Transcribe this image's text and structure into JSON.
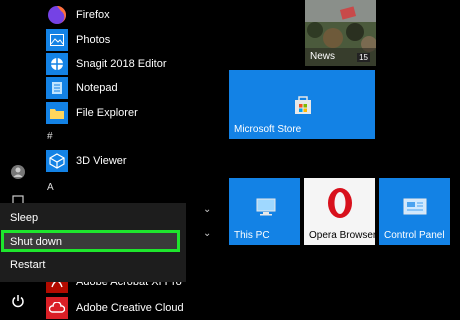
{
  "apps": [
    {
      "label": "Firefox",
      "icon": "firefox-icon"
    },
    {
      "label": "Photos",
      "icon": "photos-icon"
    },
    {
      "label": "Snagit 2018 Editor",
      "icon": "snagit-icon"
    },
    {
      "label": "Notepad",
      "icon": "notepad-icon"
    },
    {
      "label": "File Explorer",
      "icon": "file-explorer-icon"
    },
    {
      "label": "3D Viewer",
      "icon": "3d-viewer-icon"
    },
    {
      "label": "Adobe Acrobat XI Pro",
      "icon": "acrobat-icon"
    },
    {
      "label": "Adobe Creative Cloud",
      "icon": "creative-cloud-icon"
    }
  ],
  "section_headers": {
    "hash": "#",
    "a": "A"
  },
  "power_menu": {
    "sleep": "Sleep",
    "shut_down": "Shut down",
    "restart": "Restart"
  },
  "tiles": {
    "news": "News",
    "news_badge": "15",
    "store": "Microsoft Store",
    "this_pc": "This PC",
    "opera": "Opera Browser",
    "control_panel": "Control Panel"
  },
  "colors": {
    "tile_blue": "#1382e5",
    "highlight": "#1ee62d",
    "menu_bg": "#1d1d1d"
  }
}
